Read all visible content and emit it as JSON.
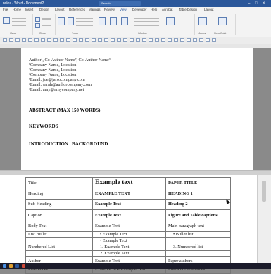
{
  "titlebar": {
    "title": "ndios - Word - Document2",
    "search": "Search"
  },
  "tabs": [
    "File",
    "Home",
    "Insert",
    "Design",
    "Layout",
    "References",
    "Mailings",
    "Review",
    "View",
    "Developer",
    "Help",
    "Acrobat",
    "Table Design",
    "Layout"
  ],
  "ribbon": {
    "groups": [
      "Views",
      "Show",
      "Zoom",
      "Window",
      "Macros",
      "SharePoint"
    ]
  },
  "document": {
    "authors": "Author¹, Co-Author Name², Co-Author Name³",
    "affil1": "¹Company Name, Location",
    "affil2": "²Company Name, Location",
    "affil3": "³Company Name, Location",
    "email1": "¹Email: joe@jarsocompany.com",
    "email2": "²Email: sarah@authorcompany.com",
    "email3": "³Email: amy@amycompany.net",
    "abstract": "ABSTRACT (MAX 150 WORDS)",
    "keywords": "KEYWORDS",
    "intro": "INTRODUCTION | BACKGROUND"
  },
  "table": {
    "rows": [
      [
        "Title",
        "Example text",
        "PAPER TITLE"
      ],
      [
        "Heading",
        "EXAMPLE TEXT",
        "HEADING 1"
      ],
      [
        "Sub-Heading",
        "Example Text",
        "Heading 2"
      ],
      [
        "Caption",
        "Example Text",
        "Figure and Table captions"
      ],
      [
        "Body Text",
        "Example Text",
        "Main paragraph text"
      ],
      [
        "List Bullet",
        "• Example Text",
        "• Bullet list"
      ],
      [
        "",
        "• Example Text",
        ""
      ],
      [
        "Numbered List",
        "1. Example Text",
        "3. Numbered list"
      ],
      [
        "",
        "2. Example Text",
        ""
      ],
      [
        "Author",
        "Example Text",
        "Paper authors"
      ],
      [
        "References",
        "Example Text Example Text",
        "Literature references"
      ]
    ]
  }
}
